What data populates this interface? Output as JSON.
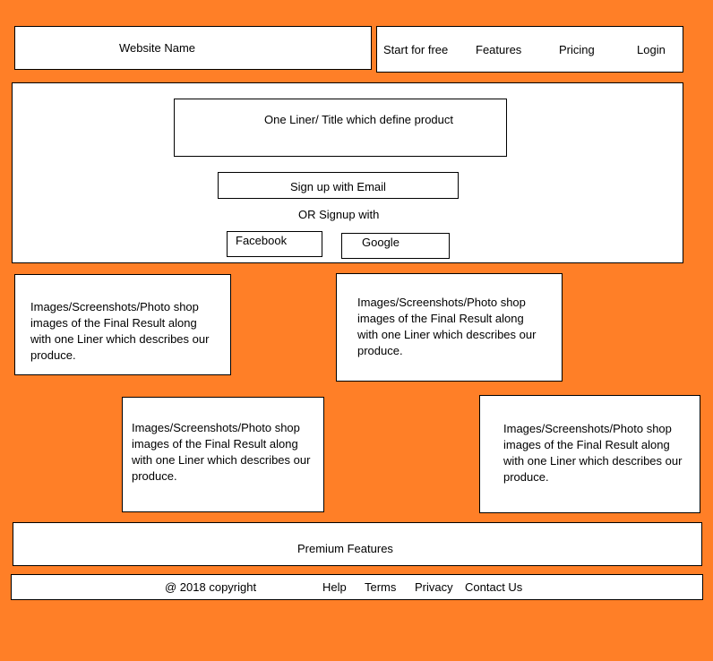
{
  "header": {
    "site_name": "Website Name",
    "nav": {
      "start": "Start for free",
      "features": "Features",
      "pricing": "Pricing",
      "login": "Login"
    }
  },
  "hero": {
    "title": "One Liner/ Title  which define product",
    "signup_email": "Sign up with Email",
    "or_text": "OR  Signup with",
    "facebook": "Facebook",
    "google": "Google"
  },
  "showcase": {
    "card1": "Images/Screenshots/Photo shop images of the Final Result along with one Liner which describes our produce.",
    "card2": "Images/Screenshots/Photo shop images of the Final Result along with one Liner which describes our produce.",
    "card3": "Images/Screenshots/Photo shop images of the Final Result along with one Liner which describes our produce.",
    "card4": "Images/Screenshots/Photo shop images of the Final Result along with one Liner which describes our produce."
  },
  "premium": {
    "label": "Premium Features"
  },
  "footer": {
    "copyright": "@ 2018 copyright",
    "help": "Help",
    "terms": "Terms",
    "privacy": "Privacy",
    "contact": "Contact Us"
  }
}
